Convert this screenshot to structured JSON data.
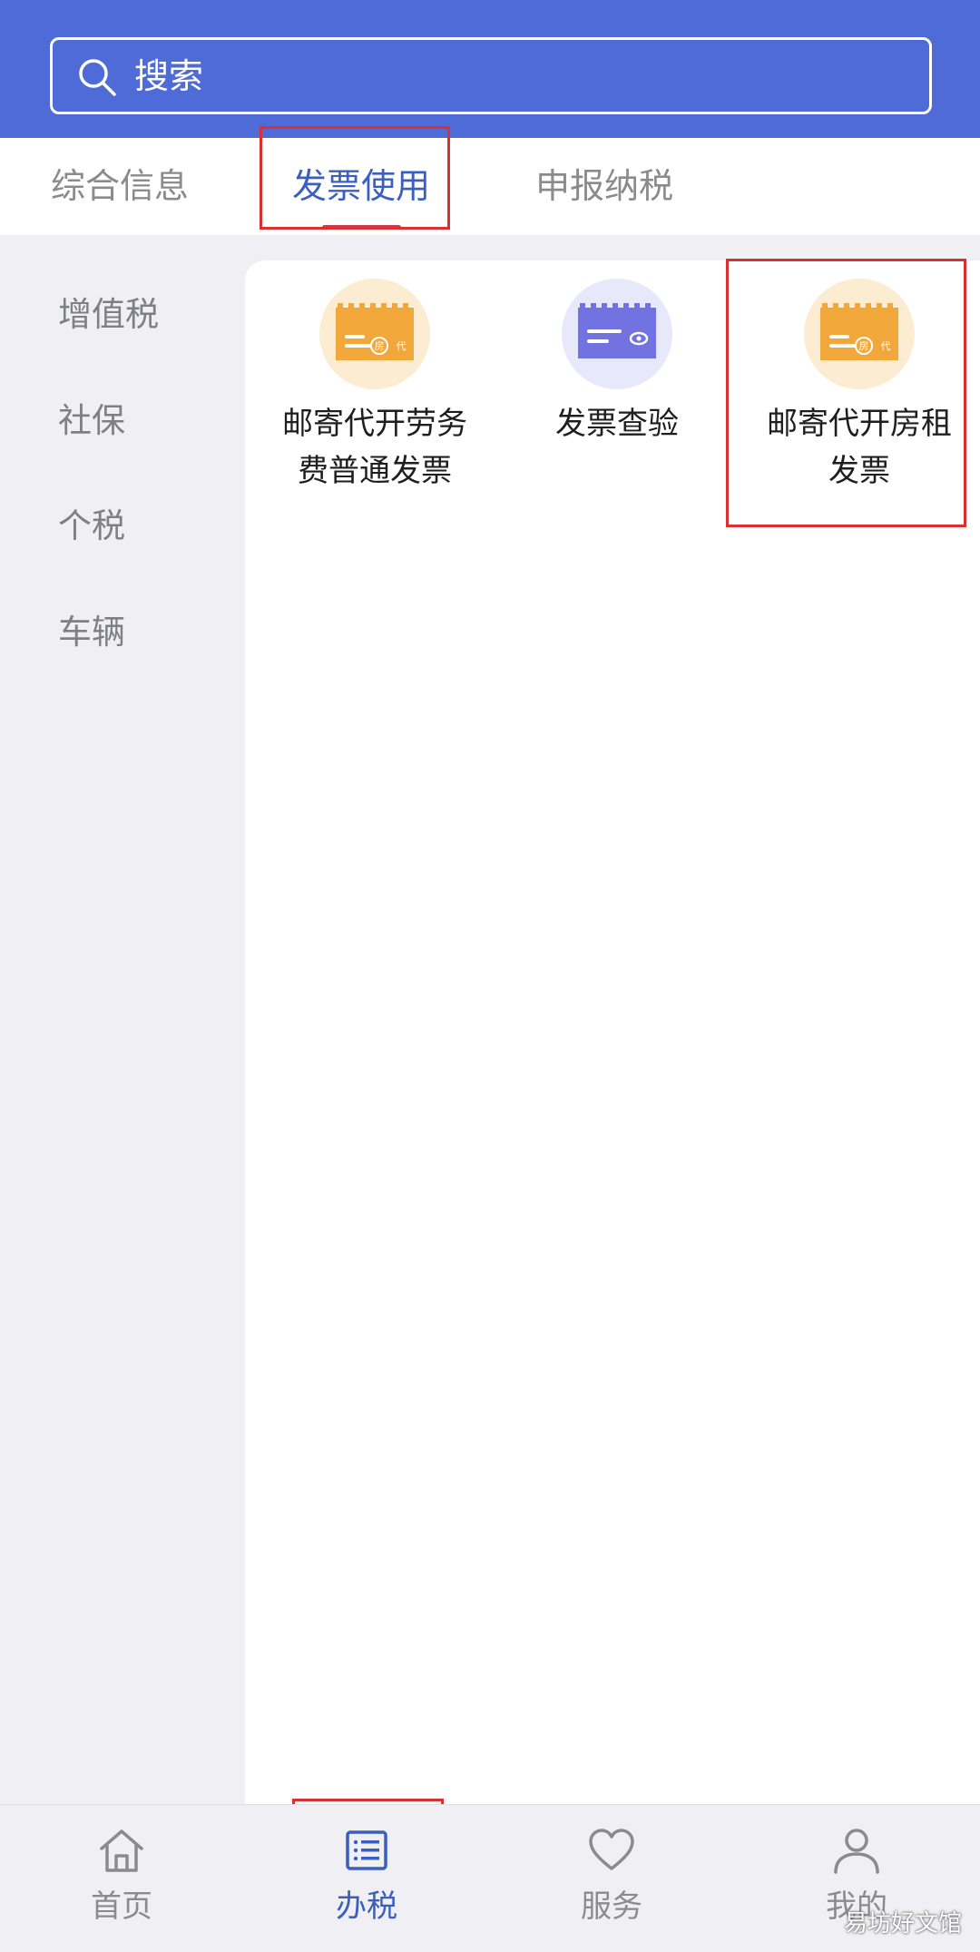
{
  "search": {
    "placeholder": "搜索"
  },
  "tabs": [
    {
      "label": "综合信息",
      "active": false
    },
    {
      "label": "发票使用",
      "active": true
    },
    {
      "label": "申报纳税",
      "active": false
    }
  ],
  "sidebar": {
    "items": [
      {
        "label": "增值税"
      },
      {
        "label": "社保"
      },
      {
        "label": "个税"
      },
      {
        "label": "车辆"
      }
    ]
  },
  "services": [
    {
      "label": "邮寄代开劳务费普通发票",
      "icon": "invoice-orange-icon",
      "icon_text": "房",
      "icon_text2": "代"
    },
    {
      "label": "发票查验",
      "icon": "invoice-check-purple-icon"
    },
    {
      "label": "邮寄代开房租发票",
      "icon": "invoice-orange-icon",
      "icon_text": "房",
      "icon_text2": "代"
    }
  ],
  "bottom_nav": [
    {
      "label": "首页",
      "icon": "home-icon",
      "active": false
    },
    {
      "label": "办税",
      "icon": "list-icon",
      "active": true
    },
    {
      "label": "服务",
      "icon": "heart-icon",
      "active": false
    },
    {
      "label": "我的",
      "icon": "user-icon",
      "active": false
    }
  ],
  "watermark": "易坊好文馆",
  "colors": {
    "header_bg": "#4f6bd8",
    "accent": "#3a5fbf",
    "orange_icon": "#f2a73a",
    "purple_icon": "#7272e0",
    "annotation": "#d93030"
  }
}
